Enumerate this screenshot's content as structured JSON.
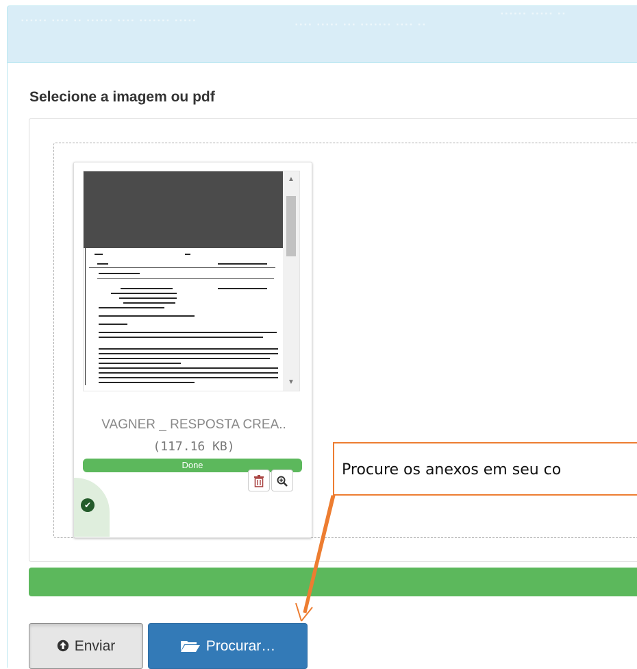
{
  "section": {
    "title": "Selecione a imagem ou pdf"
  },
  "file": {
    "name": "VAGNER _ RESPOSTA CREA..",
    "size": "(117.16 KB)",
    "status": "Done",
    "progress_fraction": 1.0
  },
  "upload": {
    "progress_fraction": 1.0
  },
  "buttons": {
    "enviar_label": "Enviar",
    "procurar_label": "Procurar…"
  },
  "callout": {
    "text": "Procure os anexos em seu co"
  },
  "icons": {
    "upload": "circle-arrow-up-icon",
    "folder": "folder-open-icon",
    "trash": "trash-icon",
    "zoom": "zoom-in-icon",
    "check": "check-circle-icon"
  },
  "colors": {
    "header_bg": "#d9edf7",
    "success": "#5cb85c",
    "primary": "#337ab7",
    "danger": "#a94442",
    "callout_border": "#ed7d31"
  }
}
